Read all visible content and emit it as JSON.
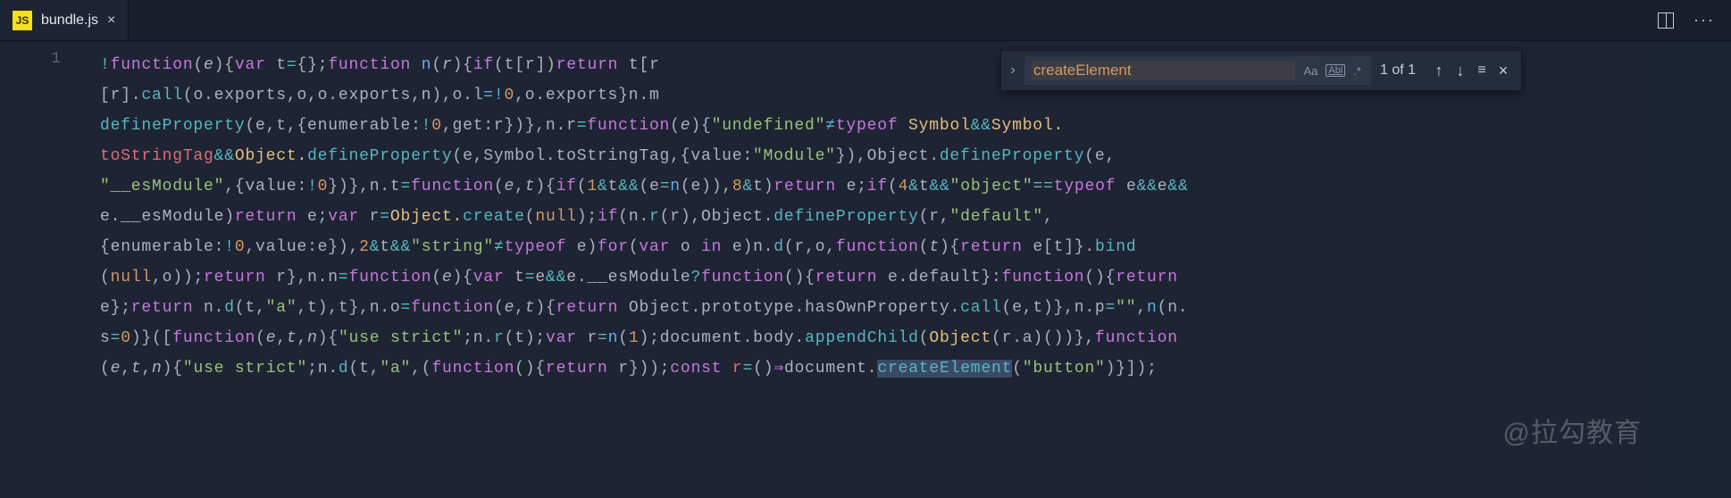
{
  "tab": {
    "icon_label": "JS",
    "filename": "bundle.js"
  },
  "gutter": {
    "line1": "1"
  },
  "find": {
    "query": "createElement",
    "count_text": "1 of 1",
    "opt_case": "Aa",
    "opt_word": "Abl",
    "opt_regex": ".*"
  },
  "watermark": "@拉勾教育",
  "code": {
    "l1a": "!",
    "l1b": "function",
    "l1c": "(",
    "l1d": "e",
    "l1e": "){",
    "l1f": "var",
    "l1g": " t",
    "l1h": "=",
    "l1i": "{};",
    "l1j": "function",
    "l1k": " n",
    "l1l": "(",
    "l1m": "r",
    "l1n": "){",
    "l1o": "if",
    "l1p": "(t[r])",
    "l1q": "return",
    "l1r": " t[r",
    "l2a": "[r].",
    "l2b": "call",
    "l2c": "(o.exports,o,o.exports,n),o.l",
    "l2d": "=!",
    "l2e": "0",
    "l2f": ",o.exports}n.m",
    "l3a": "defineProperty",
    "l3b": "(e,t,{enumerable:",
    "l3c": "!",
    "l3d": "0",
    "l3e": ",get:r})},n.r",
    "l3f": "=",
    "l3g": "function",
    "l3h": "(",
    "l3i": "e",
    "l3j": "){",
    "l3k": "\"undefined\"",
    "l3l": "≠",
    "l3m": "typeof",
    "l3n": " Symbol",
    "l3o": "&&",
    "l3p": "Symbol.",
    "l4a": "toStringTag",
    "l4b": "&&",
    "l4c": "Object.",
    "l4d": "defineProperty",
    "l4e": "(e,Symbol.toStringTag,{value:",
    "l4f": "\"Module\"",
    "l4g": "}),Object.",
    "l4h": "defineProperty",
    "l4i": "(e,",
    "l5a": "\"__esModule\"",
    "l5b": ",{value:",
    "l5c": "!",
    "l5d": "0",
    "l5e": "})},n.t",
    "l5f": "=",
    "l5g": "function",
    "l5h": "(",
    "l5i": "e",
    "l5j": ",",
    "l5k": "t",
    "l5l": "){",
    "l5m": "if",
    "l5n": "(",
    "l5o": "1",
    "l5p": "&",
    "l5q": "t",
    "l5r": "&&",
    "l5s": "(e",
    "l5t": "=",
    "l5u": "n",
    "l5v": "(e)),",
    "l5w": "8",
    "l5x": "&",
    "l5y": "t)",
    "l5z": "return",
    "l5aa": " e;",
    "l5ab": "if",
    "l5ac": "(",
    "l5ad": "4",
    "l5ae": "&",
    "l5af": "t",
    "l5ag": "&&",
    "l5ah": "\"object\"",
    "l5ai": "==",
    "l5aj": "typeof",
    "l5ak": " e",
    "l5al": "&&",
    "l5am": "e",
    "l5an": "&&",
    "l6a": "e.__esModule)",
    "l6b": "return",
    "l6c": " e;",
    "l6d": "var",
    "l6e": " r",
    "l6f": "=",
    "l6g": "Object.",
    "l6h": "create",
    "l6i": "(",
    "l6j": "null",
    "l6k": ");",
    "l6l": "if",
    "l6m": "(n.",
    "l6n": "r",
    "l6o": "(r),Object.",
    "l6p": "defineProperty",
    "l6q": "(r,",
    "l6r": "\"default\"",
    "l6s": ",",
    "l7a": "{enumerable:",
    "l7b": "!",
    "l7c": "0",
    "l7d": ",value:e}),",
    "l7e": "2",
    "l7f": "&",
    "l7g": "t",
    "l7h": "&&",
    "l7i": "\"string\"",
    "l7j": "≠",
    "l7k": "typeof",
    "l7l": " e)",
    "l7m": "for",
    "l7n": "(",
    "l7o": "var",
    "l7p": " o ",
    "l7q": "in",
    "l7r": " e)n.",
    "l7s": "d",
    "l7t": "(r,o,",
    "l7u": "function",
    "l7v": "(",
    "l7w": "t",
    "l7x": "){",
    "l7y": "return",
    "l7z": " e[t]}.",
    "l7aa": "bind",
    "l8a": "(",
    "l8b": "null",
    "l8c": ",o));",
    "l8d": "return",
    "l8e": " r},n.n",
    "l8f": "=",
    "l8g": "function",
    "l8h": "(",
    "l8i": "e",
    "l8j": "){",
    "l8k": "var",
    "l8l": " t",
    "l8m": "=",
    "l8n": "e",
    "l8o": "&&",
    "l8p": "e.__esModule",
    "l8q": "?",
    "l8r": "function",
    "l8s": "(){",
    "l8t": "return",
    "l8u": " e.default}:",
    "l8v": "function",
    "l8w": "(){",
    "l8x": "return",
    "l9a": "e};",
    "l9b": "return",
    "l9c": " n.",
    "l9d": "d",
    "l9e": "(t,",
    "l9f": "\"a\"",
    "l9g": ",t),t},n.o",
    "l9h": "=",
    "l9i": "function",
    "l9j": "(",
    "l9k": "e",
    "l9l": ",",
    "l9m": "t",
    "l9n": "){",
    "l9o": "return",
    "l9p": " Object.prototype.hasOwnProperty.",
    "l9q": "call",
    "l9r": "(e,t)},n.p",
    "l9s": "=",
    "l9t": "\"\"",
    "l9u": ",",
    "l9v": "n",
    "l9w": "(n.",
    "l10a": "s",
    "l10b": "=",
    "l10c": "0",
    "l10d": ")}([",
    "l10e": "function",
    "l10f": "(",
    "l10g": "e",
    "l10h": ",",
    "l10i": "t",
    "l10j": ",",
    "l10k": "n",
    "l10l": "){",
    "l10m": "\"use strict\"",
    "l10n": ";n.",
    "l10o": "r",
    "l10p": "(t);",
    "l10q": "var",
    "l10r": " r",
    "l10s": "=",
    "l10t": "n",
    "l10u": "(",
    "l10v": "1",
    "l10w": ");document.body.",
    "l10x": "appendChild",
    "l10y": "(",
    "l10z": "Object",
    "l10aa": "(r.a)())},",
    "l10ab": "function",
    "l11a": "(",
    "l11b": "e",
    "l11c": ",",
    "l11d": "t",
    "l11e": ",",
    "l11f": "n",
    "l11g": "){",
    "l11h": "\"use strict\"",
    "l11i": ";n.",
    "l11j": "d",
    "l11k": "(t,",
    "l11l": "\"a\"",
    "l11m": ",(",
    "l11n": "function",
    "l11o": "(){",
    "l11p": "return",
    "l11q": " r}));",
    "l11r": "const",
    "l11s": " r",
    "l11t": "=",
    "l11u": "()",
    "l11v": "⇒",
    "l11w": "document.",
    "l11x": "createElement",
    "l11y": "(",
    "l11z": "\"button\"",
    "l11aa": ")}]);"
  }
}
